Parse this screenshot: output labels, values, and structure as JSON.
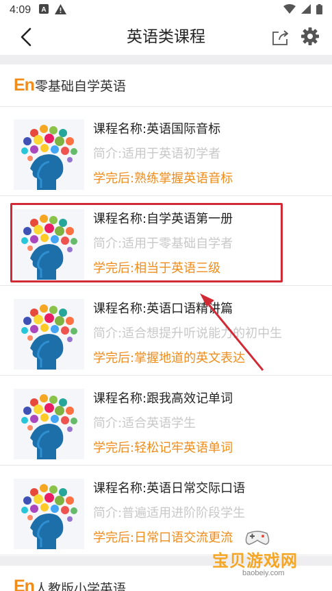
{
  "status_bar": {
    "time": "4:09"
  },
  "nav": {
    "title": "英语类课程"
  },
  "sections": [
    {
      "logo": "En",
      "title": "零基础自学英语",
      "courses": [
        {
          "name": "课程名称:英语国际音标",
          "intro": "简介:适用于英语初学者",
          "after": "学完后:熟练掌握英语音标"
        },
        {
          "name": "课程名称:自学英语第一册",
          "intro": "简介:适用于零基础自学者",
          "after": "学完后:相当于英语三级"
        },
        {
          "name": "课程名称:英语口语精讲篇",
          "intro": "简介:适合想提升听说能力的初中生",
          "after": "学完后:掌握地道的英文表达"
        },
        {
          "name": "课程名称:跟我高效记单词",
          "intro": "简介:适合英语学生",
          "after": "学完后:轻松记牢英语单词"
        },
        {
          "name": "课程名称:英语日常交际口语",
          "intro": "简介:普遍适用进阶阶段学生",
          "after": "学完后:日常口语交流更流"
        }
      ]
    },
    {
      "logo": "En",
      "title": "人教版小学英语"
    }
  ],
  "watermark": {
    "text": "宝贝游戏网",
    "url": "baobeiy.com"
  },
  "colors": {
    "accent_orange": "#f08c1a",
    "highlight_red": "#d22a35",
    "intro_gray": "#c8c8c8"
  }
}
